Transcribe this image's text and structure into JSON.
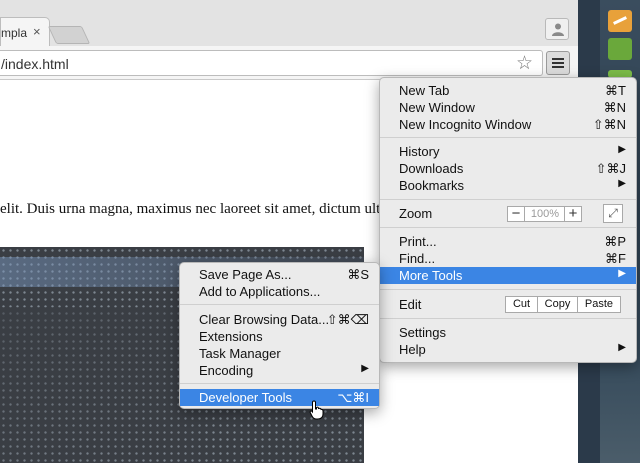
{
  "tab": {
    "title": "mpla",
    "close_glyph": "×"
  },
  "omnibox": {
    "url": "/index.html"
  },
  "page": {
    "paragraph": "elit. Duis urna magna, maximus nec laoreet sit amet, dictum ultr"
  },
  "main_menu": {
    "new_tab": {
      "label": "New Tab",
      "shortcut": "⌘T"
    },
    "new_window": {
      "label": "New Window",
      "shortcut": "⌘N"
    },
    "new_incognito": {
      "label": "New Incognito Window",
      "shortcut": "⇧⌘N"
    },
    "history": {
      "label": "History"
    },
    "downloads": {
      "label": "Downloads",
      "shortcut": "⇧⌘J"
    },
    "bookmarks": {
      "label": "Bookmarks"
    },
    "zoom": {
      "label": "Zoom",
      "minus": "−",
      "value": "100%",
      "plus": "+"
    },
    "print": {
      "label": "Print...",
      "shortcut": "⌘P"
    },
    "find": {
      "label": "Find...",
      "shortcut": "⌘F"
    },
    "more_tools": {
      "label": "More Tools"
    },
    "edit": {
      "label": "Edit",
      "cut": "Cut",
      "copy": "Copy",
      "paste": "Paste"
    },
    "settings": {
      "label": "Settings"
    },
    "help": {
      "label": "Help"
    },
    "submenu_arrow": "▶"
  },
  "sub_menu": {
    "save_page": {
      "label": "Save Page As...",
      "shortcut": "⌘S"
    },
    "add_to_apps": {
      "label": "Add to Applications..."
    },
    "clear_data": {
      "label": "Clear Browsing Data...",
      "shortcut": "⇧⌘⌫"
    },
    "extensions": {
      "label": "Extensions"
    },
    "task_manager": {
      "label": "Task Manager"
    },
    "encoding": {
      "label": "Encoding"
    },
    "developer_tools": {
      "label": "Developer Tools",
      "shortcut": "⌥⌘I"
    }
  },
  "colors": {
    "highlight": "#3b85e4",
    "menu_bg": "#ebebeb"
  }
}
